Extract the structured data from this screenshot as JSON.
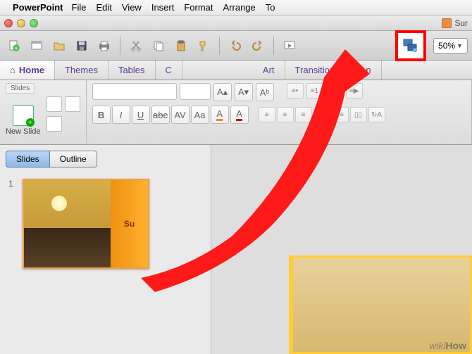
{
  "menubar": {
    "app": "PowerPoint",
    "items": [
      "File",
      "Edit",
      "View",
      "Insert",
      "Format",
      "Arrange",
      "To"
    ]
  },
  "window": {
    "doc_title": "Sur"
  },
  "toolbar": {
    "zoom_value": "50%"
  },
  "ribbon_tabs": {
    "home": "Home",
    "themes": "Themes",
    "tables": "Tables",
    "c": "C",
    "art": "Art",
    "transitions": "Transitions",
    "an": "An"
  },
  "ribbon": {
    "slides_label": "Slides",
    "new_slide": "New Slide",
    "bold": "B",
    "italic": "I",
    "underline": "U",
    "aa_case": "Aa",
    "font_color": "A",
    "font_color2": "A"
  },
  "sidepanel": {
    "tab_slides": "Slides",
    "tab_outline": "Outline",
    "slide1_num": "1",
    "slide1_title": "Su"
  },
  "watermark": {
    "prefix": "wiki",
    "suffix": "How"
  }
}
